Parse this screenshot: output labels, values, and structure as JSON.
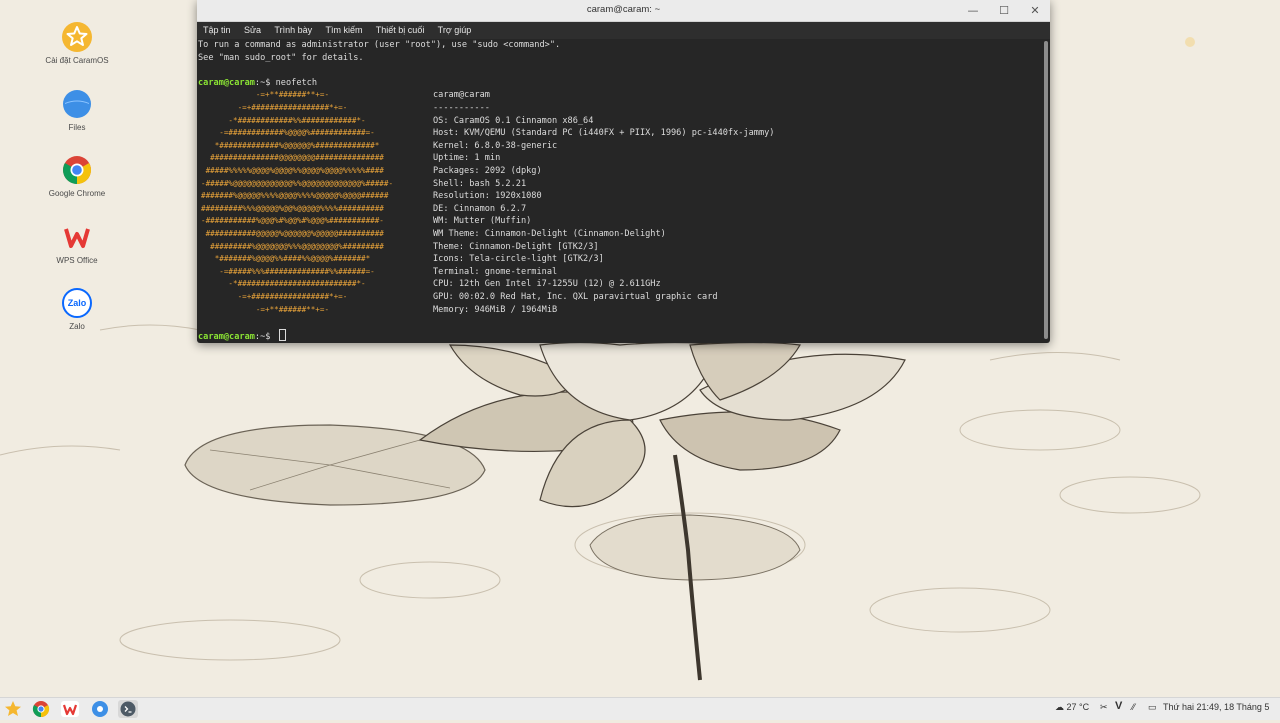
{
  "window": {
    "title": "caram@caram: ~",
    "minimize_icon": "minimize-icon",
    "maximize_icon": "maximize-icon",
    "close_icon": "close-icon"
  },
  "menu": [
    "Tập tin",
    "Sửa",
    "Trình bày",
    "Tìm kiếm",
    "Thiết bị cuối",
    "Trợ giúp"
  ],
  "terminal": {
    "intro_1": "To run a command as administrator (user \"root\"), use \"sudo <command>\".",
    "intro_2": "See \"man sudo_root\" for details.",
    "prompt": "caram@caram",
    "prompt_suffix": ":~$ ",
    "command": "neofetch",
    "logo": [
      "            -=+**######**+=-",
      "        -=+#################*+=-",
      "      -*############%%############*-",
      "    -=############%@@@@%############=-",
      "   *#############%@@@@@@%#############*",
      "  ###############@@@@@@@@###############",
      " #####%%%%%@@@@%@@@@%%@@@@%@@@@%%%%%####",
      "-#####%@@@@@@@@@@@@@%%@@@@@@@@@@@@@%#####-",
      "#######%@@@@@%%%%@@@@%%%%@@@@@%@@@@######",
      "#########%%%@@@@@%@@%@@@@@%%%%##########",
      "-###########%@@@%#%@@%#%@@@%###########-",
      " ###########@@@@@%@@@@@@%@@@@@##########",
      "  #########%@@@@@@@%%%@@@@@@@@%#########",
      "   *#######%@@@@%%####%%@@@@%#######*",
      "    -=#####%%%##############%%######=-",
      "      -*##########################*-",
      "        -=+#################*+=-",
      "            -=+**######**+=-"
    ],
    "info": [
      "caram@caram",
      "-----------",
      "OS: CaramOS 0.1 Cinnamon x86_64",
      "Host: KVM/QEMU (Standard PC (i440FX + PIIX, 1996) pc-i440fx-jammy)",
      "Kernel: 6.8.0-38-generic",
      "Uptime: 1 min",
      "Packages: 2092 (dpkg)",
      "Shell: bash 5.2.21",
      "Resolution: 1920x1080",
      "DE: Cinnamon 6.2.7",
      "WM: Mutter (Muffin)",
      "WM Theme: Cinnamon-Delight (Cinnamon-Delight)",
      "Theme: Cinnamon-Delight [GTK2/3]",
      "Icons: Tela-circle-light [GTK2/3]",
      "Terminal: gnome-terminal",
      "CPU: 12th Gen Intel i7-1255U (12) @ 2.611GHz",
      "GPU: 00:02.0 Red Hat, Inc. QXL paravirtual graphic card",
      "Memory: 946MiB / 1964MiB"
    ]
  },
  "desktop_icons": [
    {
      "label": "Cài đặt CaramOS",
      "icon": "caramos-settings-icon"
    },
    {
      "label": "Files",
      "icon": "files-icon"
    },
    {
      "label": "Google Chrome",
      "icon": "chrome-icon"
    },
    {
      "label": "WPS Office",
      "icon": "wps-office-icon"
    },
    {
      "label": "Zalo",
      "icon": "zalo-icon"
    }
  ],
  "zalo_logo_text": "Zalo",
  "taskbar": {
    "weather": "27 °C",
    "clock": "Thứ hai 21:49, 18 Tháng 5"
  },
  "colors": {
    "prompt_green": "#8ae234",
    "logo_orange": "#e8a33a",
    "terminal_bg": "#262626",
    "settings_yellow": "#f5b731",
    "files_blue": "#3d8fe6",
    "wps_red": "#e53935",
    "zalo_blue": "#0a68fe"
  }
}
